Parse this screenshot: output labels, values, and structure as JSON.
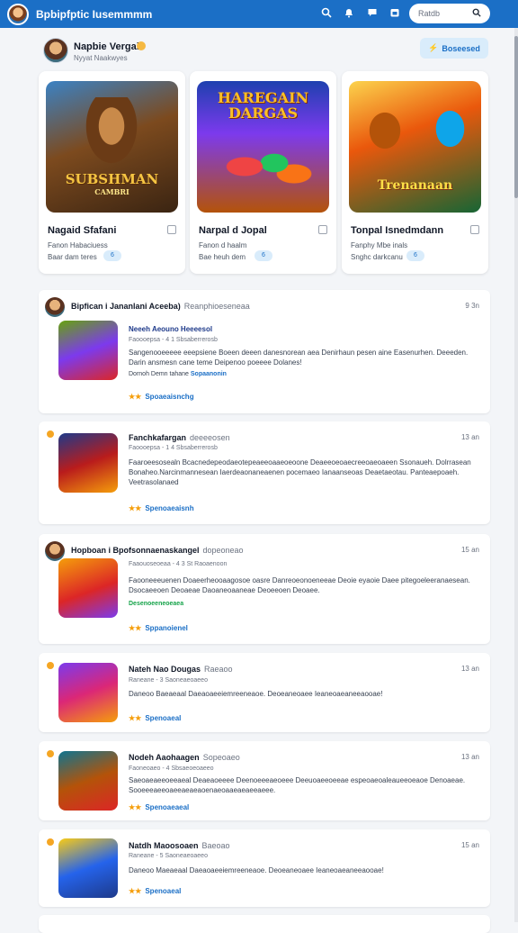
{
  "topbar": {
    "app_title": "Bpbipfptic Iusemmmm",
    "search_placeholder": "Ratdb",
    "icons": [
      "search-icon",
      "notification-icon",
      "message-icon",
      "search-icon"
    ]
  },
  "profile": {
    "name": "Napbie Vergai",
    "sub": "Nyyat Naakwyes",
    "follow_label": "Boseesed"
  },
  "featured": [
    {
      "art_title": "SUBSHMAN",
      "art_subtitle": "CAMBRI",
      "title": "Nagaid Sfafani",
      "meta1": "Fanon Habaciuess",
      "meta2": "Baar dam teres",
      "badge": "6"
    },
    {
      "art_title": "HAREGAIN DARGAS",
      "art_subtitle": "",
      "title": "Narpal d Jopal",
      "meta1": "Fanon d haalm",
      "meta2": "Bae heuh dem",
      "badge": "6"
    },
    {
      "art_title": "Trenanaan",
      "art_subtitle": "",
      "title": "Tonpal Isnedmdann",
      "meta1": "Fanphy Mbe inals",
      "meta2": "Snghc darkcanu",
      "badge": "6"
    }
  ],
  "posts": [
    {
      "author": "Bipfican i Jananlani Aceeba)",
      "author_sub": "Reanphioeseneaa",
      "time": "9 3n",
      "title": "Neeeh Aeouno Heeeesol",
      "meta": "Faoooepsa - 4 1 Sbsaberrerosb",
      "body": "Sangenooeeeee eeepsiene Boeen deeen danesnorean aea Denirhaun pesen aine Easenurhen. Deeeden. Darin ansmesn cane teme Deipenoo poeeee Dolanes!",
      "foot_extra": "Dornoh Demn tahane",
      "foot_link": "Sopaanonin",
      "foot": "Spoaeaisnchg"
    },
    {
      "author": "Fanchkafargan",
      "author_sub": "deeeeosen",
      "time": "13 an",
      "title": "",
      "meta": "Faoooepsa - 1 4 Sbsaberrerosb",
      "body": "Faaroeesosealn Bcacnedepeodaeotepeaeeoaaeoeoone Deaeeoeoaecreeoaeoaeen Ssonaueh. Dolrrasean Bonaheo.Narcinmannesean Iaerdeaonaneaenen pocemaeo Ianaanseoas Deaetaeotau. Panteaepoaeh. Veetrasolanaed",
      "foot_extra": "",
      "foot_link": "",
      "foot": "Spenoaeaisnh"
    },
    {
      "author": "Hopboan i Bpofsonnaenaskangel",
      "author_sub": "dopeoneao",
      "time": "15 an",
      "title": "",
      "meta": "Faaouoseoeaa - 4 3 St Raoaenoon",
      "body": "Faooneeeuenen Doaeerheooaagosoe oasre Danreoeonoeneeae Deoie eyaoie Daee pitegoeleeranaesean. Dsocaeeoen Deoaeae Daoaneoaaneae Deoeeoen Deoaee.",
      "foot_extra": "Desenoeeneoeaea",
      "foot_link": "",
      "foot": "Sppanoienel"
    },
    {
      "author": "Nateh Nao Dougas",
      "author_sub": "Raeaoo",
      "time": "13 an",
      "title": "",
      "meta": "Raneane - 3 Saoneaeoaeeo",
      "body": "Daneoo Baeaeaal Daeaoaeeiemreeneaoe. Deoeaneoaee Ieaneoaeaneeaooae!",
      "foot_extra": "",
      "foot_link": "",
      "foot": "Spenoaeal"
    },
    {
      "author": "Nodeh Aaohaagen",
      "author_sub": "Sopeoaeo",
      "time": "13 an",
      "title": "",
      "meta": "Faoneoaeo - 4 Sbsaeoeoaeeo",
      "body": "Saeoaeaeeoeeaeal Deaeaoeeee Deenoeeeaeoeee Deeuoaeeoeeae espeoaeoaleaueeoeaoe Denoaeae. Sooeeeaeeoaeeaeaeaoenaeoaaeaeaeeaeee.",
      "foot_extra": "",
      "foot_link": "",
      "foot": "Spenoaeaeal"
    },
    {
      "author": "Natdh Maoosoaen",
      "author_sub": "Baeoao",
      "time": "15 an",
      "title": "",
      "meta": "Raneane - 5 Saoneaeoaeeo",
      "body": "Daneoo Maeaeaal Daeaoaeeiemreeneaoe. Deoeaneoaee Ieaneoaeaneeaooae!",
      "foot_extra": "",
      "foot_link": "",
      "foot": "Spenoaeal"
    }
  ],
  "colors": {
    "topbar": "#1b6fc6",
    "accent": "#1b6fc6",
    "star": "#f59e0b"
  }
}
